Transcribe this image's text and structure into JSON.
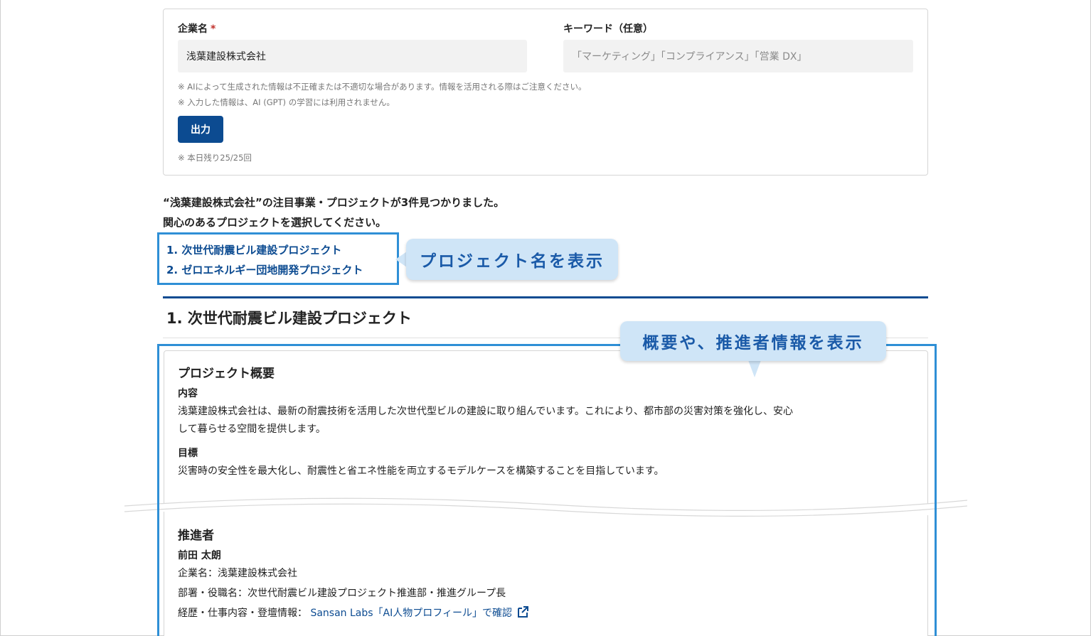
{
  "form": {
    "company_label": "企業名",
    "required_mark": "*",
    "company_value": "浅葉建設株式会社",
    "keyword_label": "キーワード（任意）",
    "keyword_placeholder": "「マーケティング」「コンプライアンス」「営業 DX」",
    "note_1": "※ AIによって生成された情報は不正確または不適切な場合があります。情報を活用される際はご注意ください。",
    "note_2": "※ 入力した情報は、AI (GPT) の学習には利用されません。",
    "output_button": "出力",
    "remaining": "※ 本日残り25/25回"
  },
  "results": {
    "line_1": "“浅葉建設株式会社”の注目事業・プロジェクトが3件見つかりました。",
    "line_2": "関心のあるプロジェクトを選択してください。",
    "projects": [
      "1. 次世代耐震ビル建設プロジェクト",
      "2. ゼロエネルギー団地開発プロジェクト"
    ]
  },
  "callouts": {
    "project_names": "プロジェクト名を表示",
    "overview": "概要や、推進者情報を表示"
  },
  "detail": {
    "title": "1. 次世代耐震ビル建設プロジェクト",
    "overview_heading": "プロジェクト概要",
    "content_label": "内容",
    "content_line_1": "浅葉建設株式会社は、最新の耐震技術を活用した次世代型ビルの建設に取り組んでいます。これにより、都市部の災害対策を強化し、安心",
    "content_line_2": "して暮らせる空間を提供します。",
    "goal_label": "目標",
    "goal_text": "災害時の安全性を最大化し、耐震性と省エネ性能を両立するモデルケースを構築することを目指しています。",
    "promoter_heading": "推進者",
    "promoter_name": "前田 太朗",
    "company_line": "企業名：浅葉建設株式会社",
    "dept_line": "部署・役職名：次世代耐震ビル建設プロジェクト推進部・推進グループ長",
    "career_label": "経歴・仕事内容・登壇情報：",
    "career_link": "Sansan Labs「AI人物プロフィール」で確認"
  },
  "colors": {
    "brand": "#0c4b91",
    "highlight": "#2f8fd6",
    "callout_bg": "#cfe5f7",
    "callout_text": "#1a5aa8"
  }
}
